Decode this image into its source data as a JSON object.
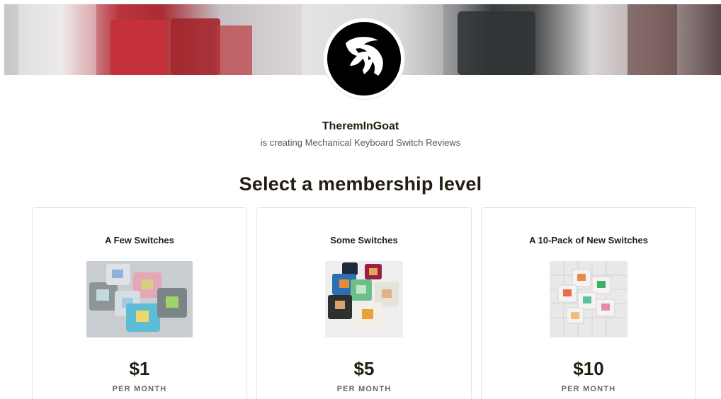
{
  "creator": {
    "name": "TheremInGoat",
    "tagline": "is creating Mechanical Keyboard Switch Reviews",
    "avatar_icon": "goat-head-icon"
  },
  "section": {
    "title": "Select a membership level"
  },
  "tiers": [
    {
      "title": "A Few Switches",
      "price": "$1",
      "period": "PER MONTH"
    },
    {
      "title": "Some Switches",
      "price": "$5",
      "period": "PER MONTH"
    },
    {
      "title": "A 10-Pack of New Switches",
      "price": "$10",
      "period": "PER MONTH"
    }
  ],
  "colors": {
    "text": "#241e12",
    "muted": "#5a5752",
    "border": "#e5e3dd"
  }
}
